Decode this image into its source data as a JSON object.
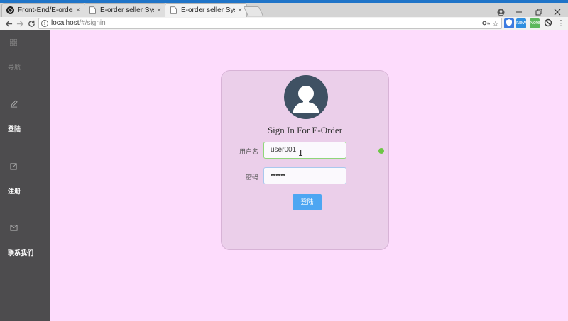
{
  "browser": {
    "tabs": [
      {
        "title": "Front-End/E-order/pub",
        "icon": "github-icon"
      },
      {
        "title": "E-order seller System",
        "icon": "page-icon"
      },
      {
        "title": "E-order seller System",
        "icon": "page-icon"
      }
    ],
    "close_glyph": "×",
    "url_host": "localhost",
    "url_path": "/#/signin",
    "ext_new_label": "New",
    "ext_note_label": "Note",
    "accent": "#1f74c8"
  },
  "sidebar": {
    "items": [
      {
        "icon": "grid-icon",
        "label": "导航"
      },
      {
        "icon": "edit-icon",
        "label": "登陆"
      },
      {
        "icon": "compose-icon",
        "label": "注册"
      },
      {
        "icon": "mail-icon",
        "label": "联系我们"
      }
    ],
    "background": "#4d4c4e"
  },
  "signin": {
    "title": "Sign In For E-Order",
    "username_label": "用户名",
    "username_value": "user001",
    "password_label": "密码",
    "password_value": "••••••",
    "submit_label": "登陆",
    "button_color": "#4da6f2",
    "page_background": "#fddcfc",
    "card_background": "#ebcfea"
  }
}
